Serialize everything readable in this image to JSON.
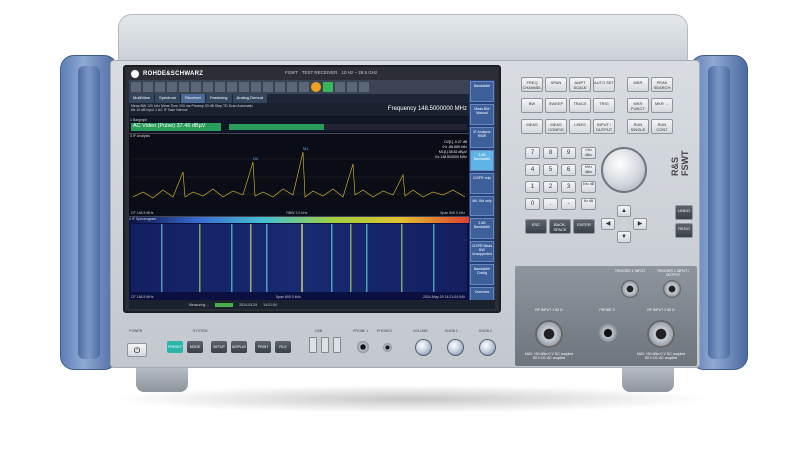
{
  "brand": "ROHDE&SCHWARZ",
  "title_bar": [
    "FSWT",
    "TEST RECEIVER",
    "10 Hz – 26.5 GHz"
  ],
  "model": "R&S FSWT",
  "screen": {
    "tabs": [
      "MultiView",
      "Spectrum",
      "Receiver",
      "Fastening",
      "Analog Demod"
    ],
    "params": [
      "Meas BW 120 kHz",
      "Meas Time 100 ms",
      "Att 10 dB",
      "Preamp 30 dB",
      "Step TD Scan Automatic",
      "Input 1 AC",
      "IF Gain",
      "Ps",
      "Narrow"
    ],
    "frequency_label": "Frequency",
    "frequency_value": "148.5000000 MHz",
    "bargraph_title": "1 Bargraph",
    "bargraph_value": "AC Video (Pulse)  37.46 dBµV",
    "bargraph_level": 0.4,
    "if_title": "3 IF Analysis",
    "markers": [
      "D2[1]   -0.27 dB",
      "0 k       -66.669 kHz",
      "M1[1]   38.82 dBµV",
      "0 k       148.500000 MHz"
    ],
    "if_cf": "CF 148.5 MHz",
    "if_rbw": "RBW 2.0 kHz",
    "if_span": "Span 690.0 kHz",
    "spec_title": "4 IF Spectrogram",
    "spec_cf": "CF 148.5 MHz",
    "spec_span": "Span 690.0 kHz",
    "spec_time": "2024-May-29 14:21:04.940",
    "status_measuring": "Measuring ...",
    "status_date": "2024-03-29",
    "status_time": "14:21:04",
    "side_buttons": [
      "Bandwidth",
      "Meas BW Manual",
      "IF Analysis RBW",
      "3 dB Bandwidth",
      "CISPR only",
      "MIL Std only",
      "3 dB Bandwidth",
      "CISPR Meas BW Unsupported",
      "Bandwidth Config",
      "Overview",
      "More 1/1"
    ]
  },
  "keys": {
    "row1": [
      "FREQ CHANNEL",
      "SPAN",
      "AMPT SCALE",
      "AUTO SET",
      "MKR",
      "PEAK SEARCH"
    ],
    "row2": [
      "BW",
      "SWEEP",
      "TRACE",
      "TRIG",
      "MKR FUNCT",
      "MKR →"
    ],
    "row3": [
      "MEAS",
      "MEAS CONFIG",
      "LINES",
      "INPUT / OUTPUT",
      "RUN SINGLE",
      "RUN CONT"
    ],
    "numpad": [
      "7",
      "8",
      "9",
      "4",
      "5",
      "6",
      "1",
      "2",
      "3",
      "0",
      ".",
      "-"
    ],
    "unit_keys": [
      "GHz dBm",
      "MHz dBm",
      "kHz dB",
      "Hz dB"
    ],
    "special": [
      "ESC",
      "BACK-SPACE",
      "ENTER"
    ],
    "side": [
      "UNDO",
      "REDO"
    ]
  },
  "connectors": {
    "trigger_input": "TRIGGER 1 INPUT",
    "trigger_output": "TRIGGER 2 INPUT / OUTPUT",
    "rf1": "RF INPUT 1 50 Ω",
    "probe": "PROBE 3",
    "rf2": "RF INPUT 2 50 Ω",
    "rf1_note": "MAX +30 dBm 0 V DC coupled 50 V DC AC coupled",
    "rf2_note": "MAX +30 dBm 0 V DC coupled 50 V DC AC coupled"
  },
  "bottom": {
    "power_label": "POWER",
    "system_label": "SYSTEM",
    "usb_label": "USB",
    "probe1_label": "PROBE 1",
    "phones_label": "PHONES",
    "volume_label": "VOLUME",
    "knob1_label": "KNOB 1",
    "knob2_label": "KNOB 2",
    "sys_buttons": [
      "PRESET",
      "MODE",
      "SETUP",
      "DISPLAY",
      "PRINT",
      "FILE"
    ]
  },
  "colors": {
    "handle": "#6f8fc4",
    "screen_bg": "#0b1020",
    "accent": "#2bb5a8"
  }
}
